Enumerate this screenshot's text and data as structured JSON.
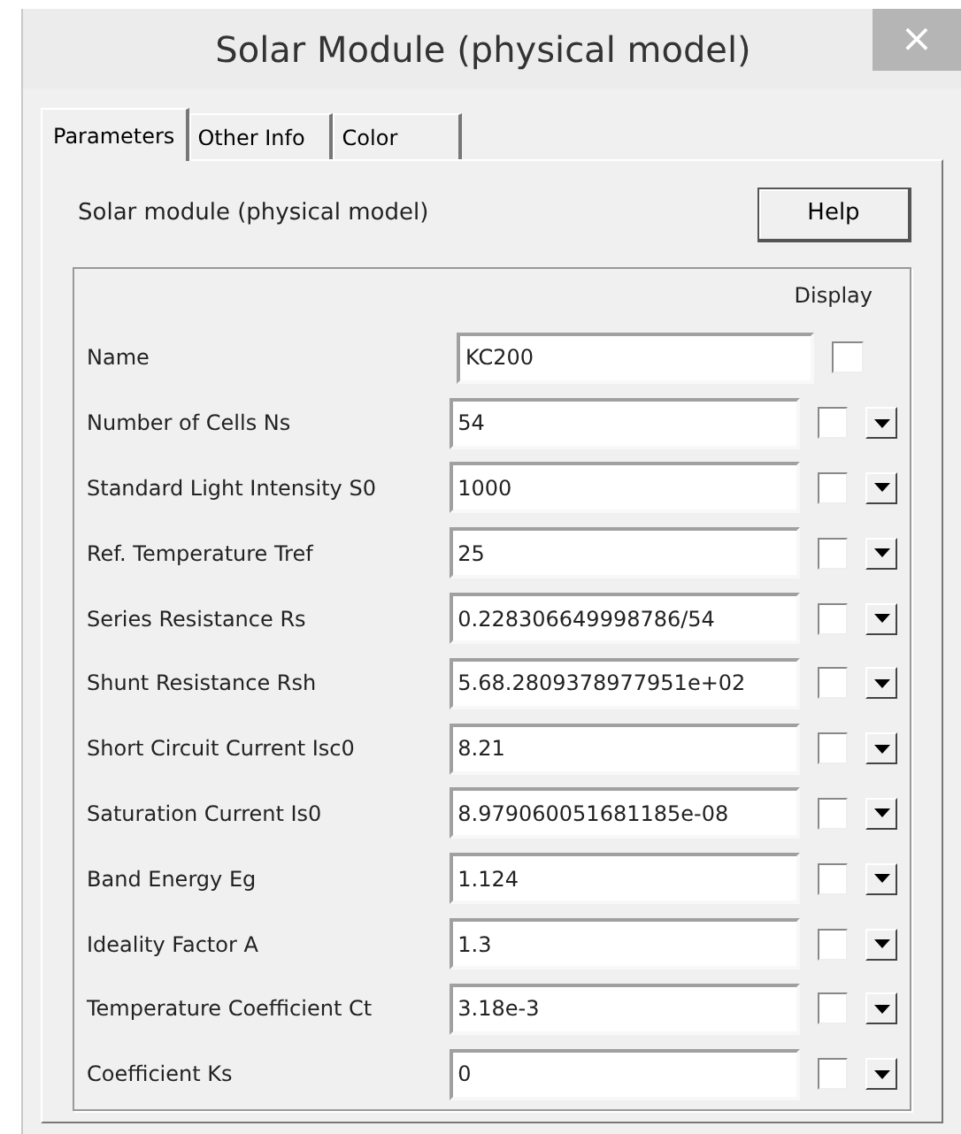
{
  "window": {
    "title": "Solar Module (physical model)",
    "close": "×"
  },
  "tabs": [
    {
      "label": "Parameters",
      "selected": true
    },
    {
      "label": "Other Info",
      "selected": false
    },
    {
      "label": "Color",
      "selected": false
    }
  ],
  "description": "Solar module (physical model)",
  "help_button": "Help",
  "display_header": "Display",
  "rows": [
    {
      "kind": "plain",
      "label": "Name",
      "value": "KC200",
      "checked": false
    },
    {
      "kind": "dropdown",
      "label": "Number of Cells Ns",
      "value": "54",
      "checked": false
    },
    {
      "kind": "dropdown",
      "label": "Standard Light Intensity S0",
      "value": "1000",
      "checked": false
    },
    {
      "kind": "dropdown",
      "label": "Ref. Temperature Tref",
      "value": "25",
      "checked": false
    },
    {
      "kind": "dropdown",
      "label": "Series Resistance Rs",
      "value": "0.228306649998786/54",
      "checked": false
    },
    {
      "kind": "dropdown",
      "label": "Shunt Resistance Rsh",
      "value": "5.68.2809378977951e+02",
      "checked": false
    },
    {
      "kind": "dropdown",
      "label": "Short Circuit Current Isc0",
      "value": "8.21",
      "checked": false
    },
    {
      "kind": "dropdown",
      "label": "Saturation Current Is0",
      "value": "8.979060051681185e-08",
      "checked": false
    },
    {
      "kind": "dropdown",
      "label": "Band Energy Eg",
      "value": "1.124",
      "checked": false
    },
    {
      "kind": "dropdown",
      "label": "Ideality Factor A",
      "value": "1.3",
      "checked": false
    },
    {
      "kind": "dropdown",
      "label": "Temperature Coefficient Ct",
      "value": "3.18e-3",
      "checked": false
    },
    {
      "kind": "dropdown",
      "label": "Coefficient Ks",
      "value": "0",
      "checked": false
    }
  ]
}
